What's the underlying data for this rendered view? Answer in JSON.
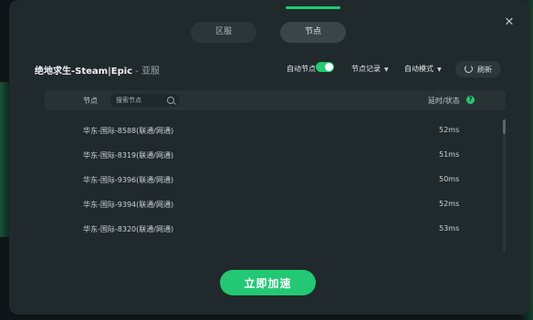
{
  "tabs": [
    {
      "label": "区服"
    },
    {
      "label": "节点"
    }
  ],
  "close_glyph": "✕",
  "header": {
    "game_name": "绝地求生-Steam|Epic",
    "separator": " - ",
    "region": "亚服"
  },
  "controls": {
    "auto_node_label": "自动节点",
    "auto_node_enabled": true,
    "node_record_label": "节点记录",
    "auto_mode_label": "自动模式",
    "refresh_label": "刷新"
  },
  "table": {
    "node_header": "节点",
    "search_placeholder": "搜索节点",
    "latency_header": "延时/状态",
    "help_glyph": "?",
    "rows": [
      {
        "name": "华东-国际-8588(联通/网通)",
        "latency": "52ms"
      },
      {
        "name": "华东-国际-8319(联通/网通)",
        "latency": "51ms"
      },
      {
        "name": "华东-国际-9396(联通/网通)",
        "latency": "50ms"
      },
      {
        "name": "华东-国际-9394(联通/网通)",
        "latency": "52ms"
      },
      {
        "name": "华东-国际-8320(联通/网通)",
        "latency": "53ms"
      }
    ]
  },
  "accelerate_label": "立即加速",
  "icons": {
    "close": "close-icon",
    "caret": "caret-down-icon",
    "refresh": "refresh-spinner-icon",
    "search": "search-icon",
    "help": "help-icon"
  },
  "colors": {
    "accent": "#1fcb73",
    "dialog_bg": "#20292b",
    "page_bg": "#0f1517"
  }
}
